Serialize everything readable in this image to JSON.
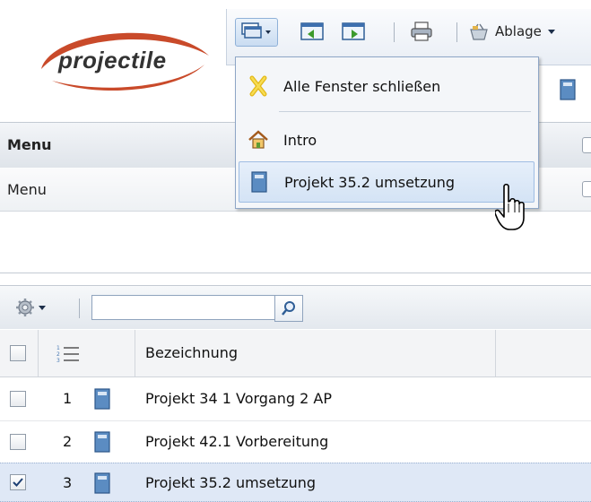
{
  "logo": {
    "text": "projectile"
  },
  "toolbar": {
    "ablage_label": "Ablage"
  },
  "dropdown": {
    "items": [
      {
        "label": "Alle Fenster schließen",
        "icon": "close-x-icon"
      },
      {
        "label": "Intro",
        "icon": "home-icon"
      },
      {
        "label": "Projekt 35.2 umsetzung",
        "icon": "book-icon"
      }
    ]
  },
  "menu_panel": {
    "header_title": "Menu",
    "sub_title": "Menu"
  },
  "grid": {
    "search": {
      "value": "",
      "placeholder": ""
    },
    "column_header": "Bezeichnung",
    "rows": [
      {
        "num": "1",
        "label": "Projekt 34 1 Vorgang 2 AP",
        "checked": false
      },
      {
        "num": "2",
        "label": "Projekt 42.1 Vorbereitung",
        "checked": false
      },
      {
        "num": "3",
        "label": "Projekt 35.2 umsetzung",
        "checked": true
      }
    ]
  },
  "colors": {
    "accent_blue": "#4a7ab3",
    "selection_bg": "#dfe8f6",
    "swoosh_red": "#c0392b"
  }
}
